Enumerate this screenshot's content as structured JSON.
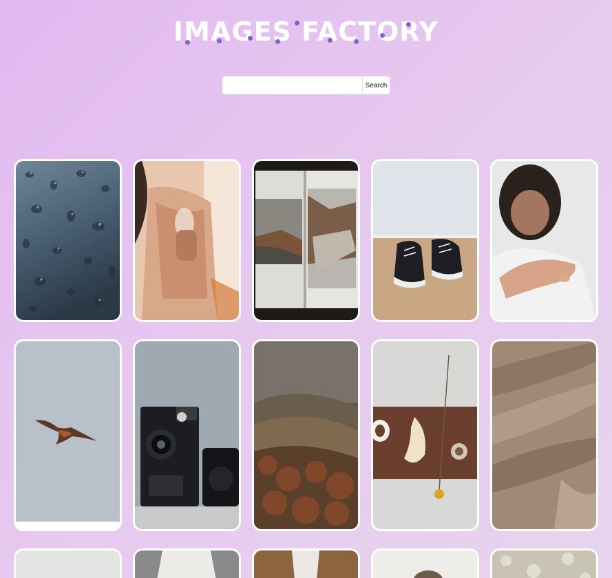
{
  "header": {
    "title": "IMAGES FACTORY"
  },
  "search": {
    "value": "",
    "placeholder": "",
    "button_label": "Search"
  },
  "colors": {
    "title_dots": "#7c63d8",
    "card_border": "#ffffff"
  },
  "gallery": {
    "images": [
      "rain-drops-on-glass",
      "woman-holding-glass",
      "open-photo-book",
      "black-sneakers-on-floor",
      "outstretched-hand",
      "bird-of-prey-flying",
      "vintage-folding-camera",
      "misty-autumn-hills",
      "flower-petal-and-tape-on-shelf",
      "sand-dune-texture",
      "photo-11",
      "photo-12",
      "photo-13",
      "photo-14",
      "photo-15"
    ]
  }
}
